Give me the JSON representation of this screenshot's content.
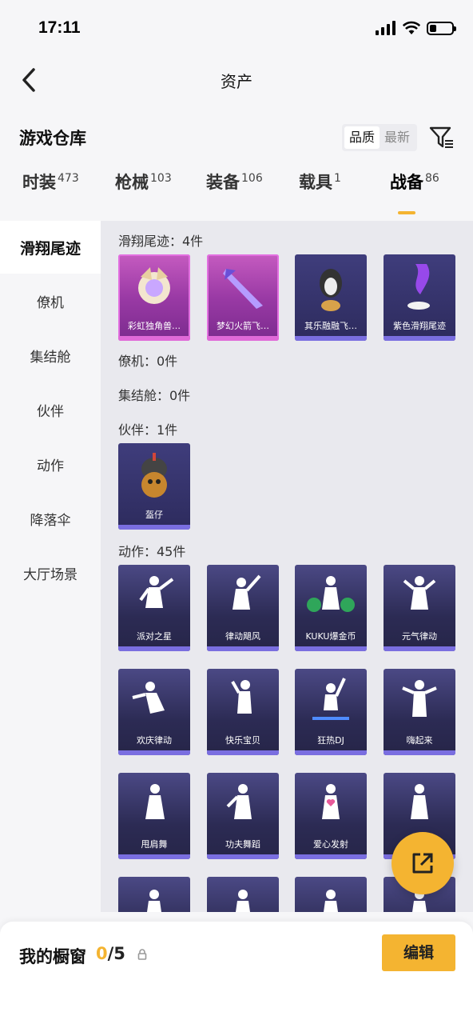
{
  "status": {
    "time": "17:11"
  },
  "nav": {
    "title": "资产"
  },
  "header": {
    "title": "游戏仓库",
    "sort_quality": "品质",
    "sort_newest": "最新"
  },
  "tabs": [
    {
      "label": "时装",
      "count": "473"
    },
    {
      "label": "枪械",
      "count": "103"
    },
    {
      "label": "装备",
      "count": "106"
    },
    {
      "label": "载具",
      "count": "1"
    },
    {
      "label": "战备",
      "count": "86"
    }
  ],
  "sidebar": [
    "滑翔尾迹",
    "僚机",
    "集结舱",
    "伙伴",
    "动作",
    "降落伞",
    "大厅场景"
  ],
  "sections": {
    "glide": {
      "title": "滑翔尾迹：4件",
      "items": [
        "彩虹独角兽…",
        "梦幻火箭飞…",
        "其乐融融飞…",
        "紫色滑翔尾迹"
      ]
    },
    "wingman": {
      "title": "僚机：0件"
    },
    "capsule": {
      "title": "集结舱：0件"
    },
    "partner": {
      "title": "伙伴：1件",
      "items": [
        "盔仔"
      ]
    },
    "emote": {
      "title": "动作：45件",
      "items": [
        "派对之星",
        "律动飓风",
        "KUKU爆金币",
        "元气律动",
        "欢庆律动",
        "快乐宝贝",
        "狂热DJ",
        "嗨起来",
        "甩肩舞",
        "功夫舞蹈",
        "爱心发射",
        ""
      ]
    }
  },
  "bottom": {
    "title": "我的橱窗",
    "current": "0",
    "total": "/5",
    "edit_label": "编辑"
  },
  "colors": {
    "accent": "#f4b431",
    "card_dark": "#2c2b54",
    "card_pink": "#c55bc0"
  },
  "icons": [
    "back-icon",
    "filter-icon",
    "share-icon",
    "lock-icon",
    "signal-icon",
    "wifi-icon",
    "battery-icon"
  ]
}
